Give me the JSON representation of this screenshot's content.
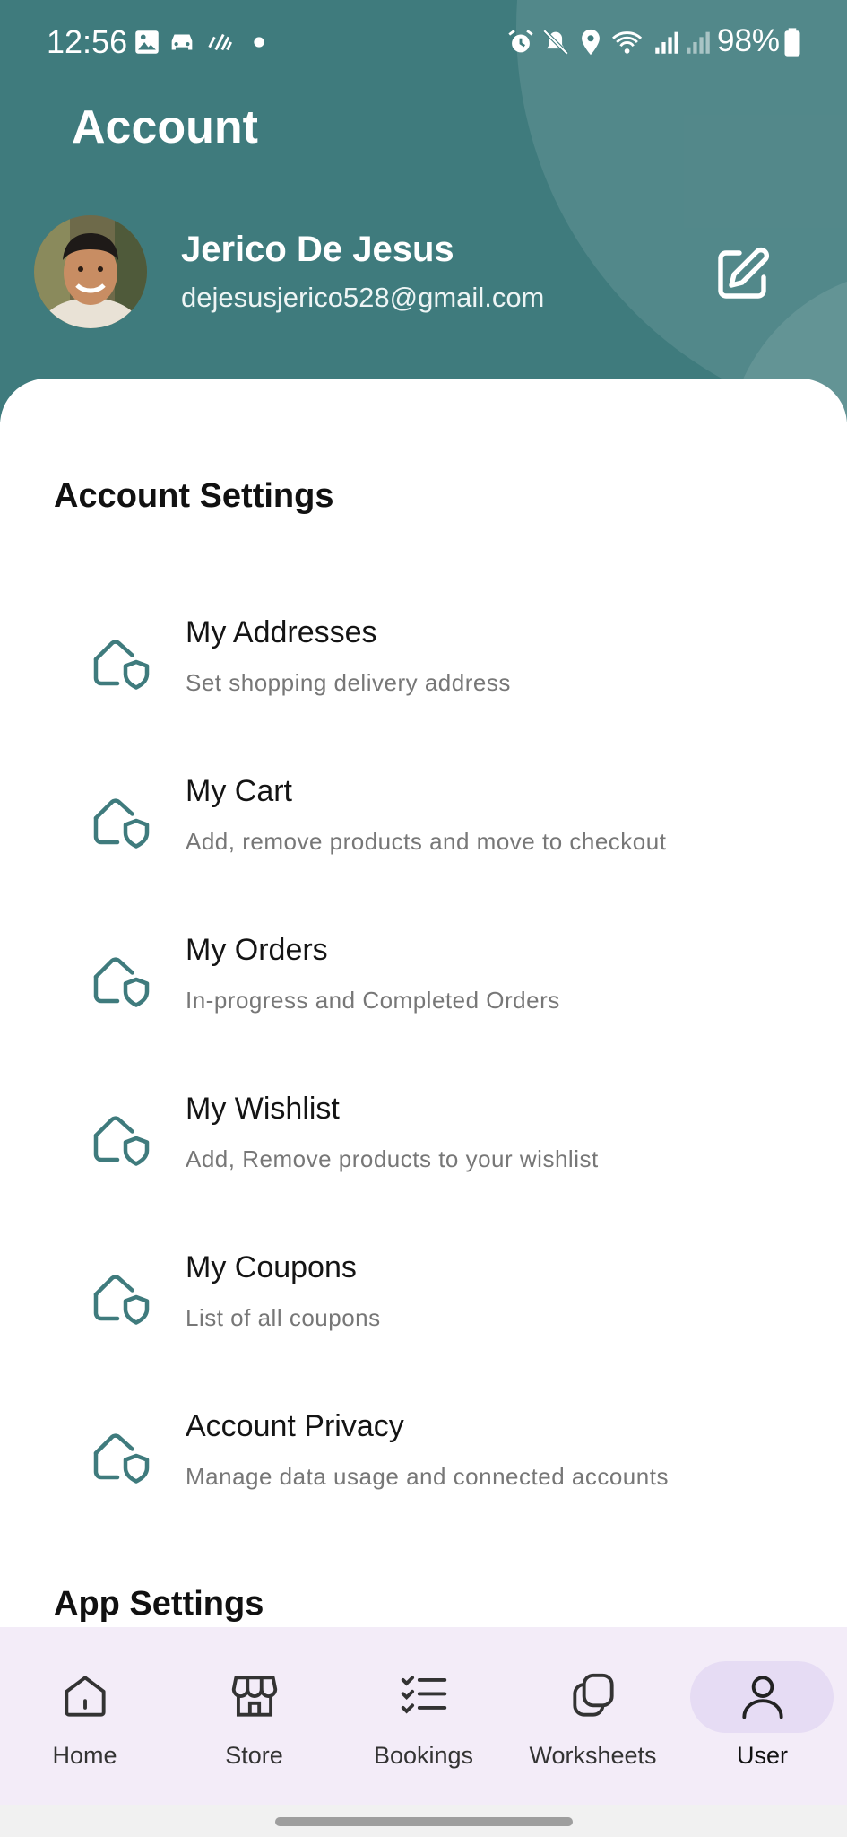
{
  "status_bar": {
    "time": "12:56",
    "battery": "98%"
  },
  "header": {
    "title": "Account",
    "user_name": "Jerico De Jesus",
    "user_email": "dejesusjerico528@gmail.com",
    "accent_color": "#3f7b7d"
  },
  "account_settings": {
    "title": "Account Settings",
    "items": [
      {
        "title": "My Addresses",
        "subtitle": "Set shopping delivery address",
        "icon": "house-shield-icon"
      },
      {
        "title": "My Cart",
        "subtitle": "Add, remove products and move to checkout",
        "icon": "house-shield-icon"
      },
      {
        "title": "My Orders",
        "subtitle": "In-progress and Completed Orders",
        "icon": "house-shield-icon"
      },
      {
        "title": "My Wishlist",
        "subtitle": "Add, Remove products to your wishlist",
        "icon": "house-shield-icon"
      },
      {
        "title": "My Coupons",
        "subtitle": "List of all coupons",
        "icon": "house-shield-icon"
      },
      {
        "title": "Account Privacy",
        "subtitle": "Manage data usage and connected accounts",
        "icon": "house-shield-icon"
      }
    ]
  },
  "app_settings": {
    "title": "App Settings"
  },
  "bottom_nav": {
    "items": [
      {
        "label": "Home",
        "icon": "home-icon"
      },
      {
        "label": "Store",
        "icon": "store-icon"
      },
      {
        "label": "Bookings",
        "icon": "checklist-icon"
      },
      {
        "label": "Worksheets",
        "icon": "stacked-cards-icon"
      },
      {
        "label": "User",
        "icon": "user-icon",
        "selected": true
      }
    ]
  }
}
